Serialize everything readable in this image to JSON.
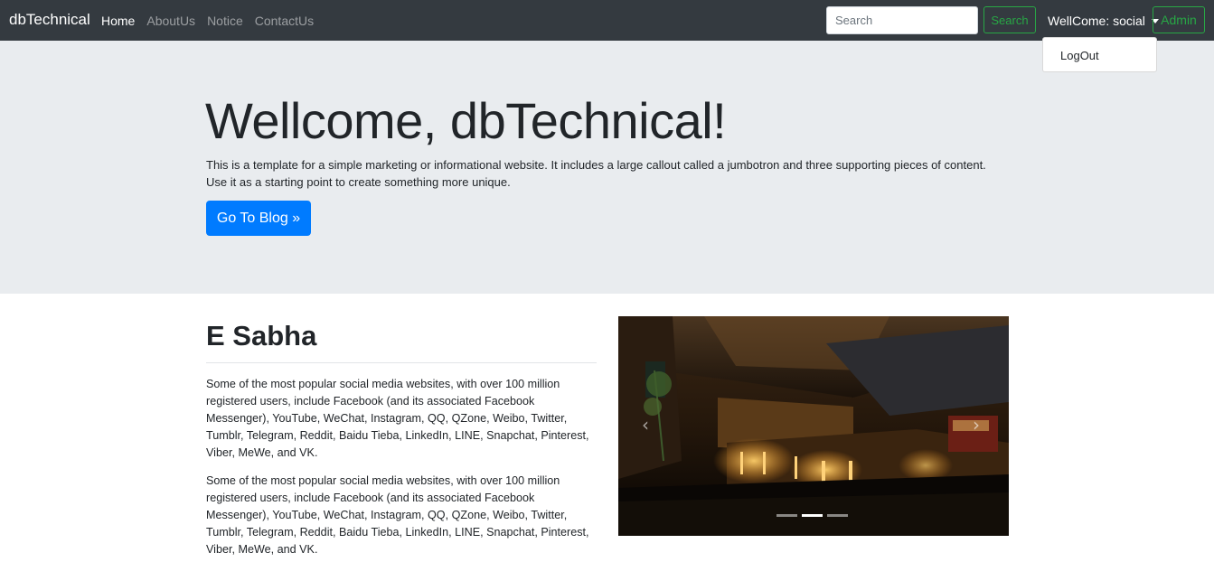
{
  "navbar": {
    "brand": "dbTechnical",
    "links": [
      {
        "label": "Home",
        "active": true
      },
      {
        "label": "AboutUs",
        "active": false
      },
      {
        "label": "Notice",
        "active": false
      },
      {
        "label": "ContactUs",
        "active": false
      }
    ],
    "search": {
      "placeholder": "Search",
      "value": "",
      "button_label": "Search"
    },
    "user_menu": {
      "label": "WellCome: social",
      "items": [
        "LogOut"
      ]
    },
    "admin_label": "Admin"
  },
  "jumbotron": {
    "title": "Wellcome, dbTechnical!",
    "text": "This is a template for a simple marketing or informational website. It includes a large callout called a jumbotron and three supporting pieces of content. Use it as a starting point to create something more unique.",
    "button_label": "Go To Blog »"
  },
  "content": {
    "title": "E Sabha",
    "paragraphs": [
      "Some of the most popular social media websites, with over 100 million registered users, include Facebook (and its associated Facebook Messenger), YouTube, WeChat, Instagram, QQ, QZone, Weibo, Twitter, Tumblr, Telegram, Reddit, Baidu Tieba, LinkedIn, LINE, Snapchat, Pinterest, Viber, MeWe, and VK.",
      "Some of the most popular social media websites, with over 100 million registered users, include Facebook (and its associated Facebook Messenger), YouTube, WeChat, Instagram, QQ, QZone, Weibo, Twitter, Tumblr, Telegram, Reddit, Baidu Tieba, LinkedIn, LINE, Snapchat, Pinterest, Viber, MeWe, and VK."
    ]
  },
  "carousel": {
    "slide_count": 3,
    "active_index": 1,
    "image": "restaurant-interior-photo",
    "prev_icon": "chevron-left-icon",
    "next_icon": "chevron-right-icon"
  },
  "colors": {
    "navbar_bg": "#343a40",
    "jumbotron_bg": "#e9ecef",
    "primary": "#007bff",
    "success_outline": "#28a745"
  }
}
